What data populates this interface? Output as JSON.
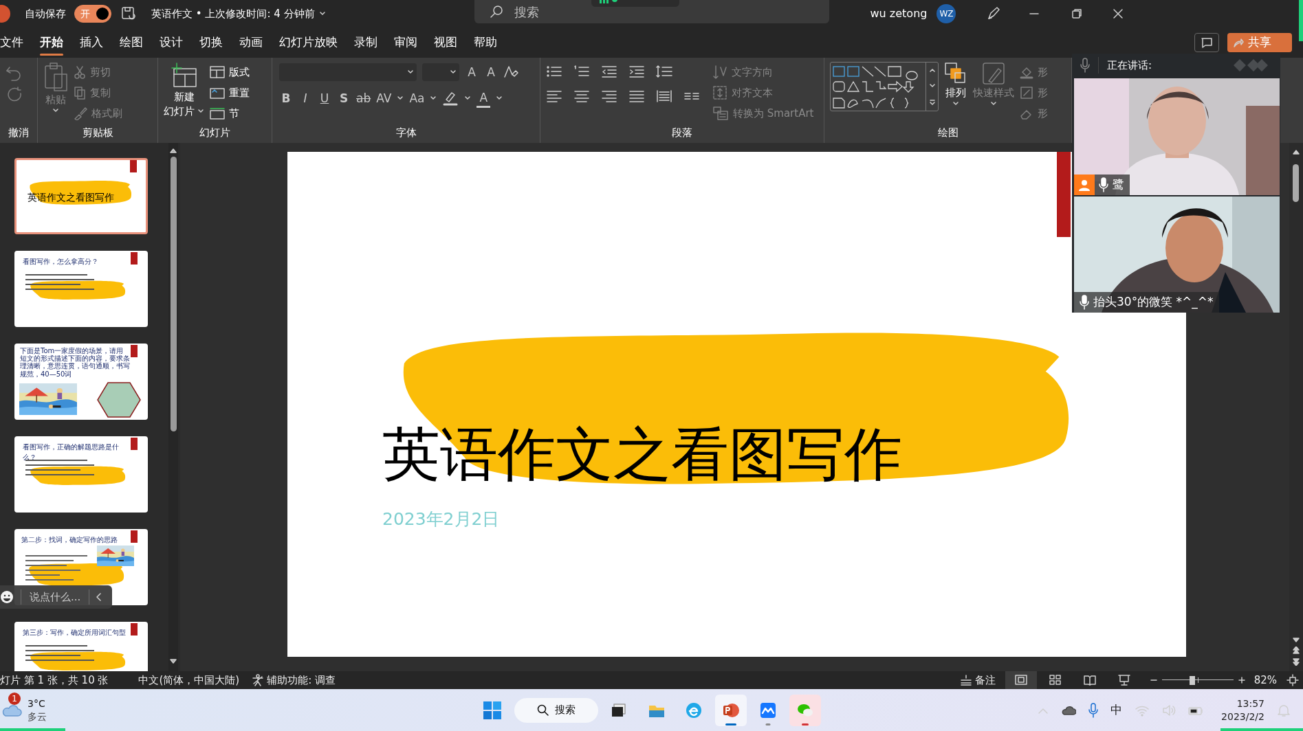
{
  "title_bar": {
    "autosave_label": "自动保存",
    "autosave_toggle": {
      "label": "开",
      "on": true
    },
    "document_title": "英语作文 • 上次修改时间: 4 分钟前",
    "search": {
      "placeholder": "搜索"
    },
    "user_name": "wu zetong",
    "avatar": "WZ"
  },
  "tabs": [
    {
      "label": "文件",
      "selected": false
    },
    {
      "label": "开始",
      "selected": true
    },
    {
      "label": "插入",
      "selected": false
    },
    {
      "label": "绘图",
      "selected": false
    },
    {
      "label": "设计",
      "selected": false
    },
    {
      "label": "切换",
      "selected": false
    },
    {
      "label": "动画",
      "selected": false
    },
    {
      "label": "幻灯片放映",
      "selected": false
    },
    {
      "label": "录制",
      "selected": false
    },
    {
      "label": "审阅",
      "selected": false
    },
    {
      "label": "视图",
      "selected": false
    },
    {
      "label": "帮助",
      "selected": false
    }
  ],
  "share_button": "共享",
  "ribbon": {
    "groups": [
      {
        "kind": "undo",
        "label": "撤消"
      },
      {
        "kind": "clipboard",
        "label": "剪贴板",
        "items": [
          {
            "label": "粘贴",
            "disabled": true
          },
          {
            "label": "剪切",
            "disabled": true
          },
          {
            "label": "复制",
            "disabled": true
          },
          {
            "label": "格式刷",
            "disabled": true
          }
        ]
      },
      {
        "kind": "slides",
        "label": "幻灯片",
        "new_slide": [
          "新建",
          "幻灯片"
        ],
        "items": [
          {
            "label": "版式",
            "disabled": false
          },
          {
            "label": "重置",
            "disabled": false
          },
          {
            "label": "节",
            "disabled": false
          }
        ]
      },
      {
        "kind": "font",
        "label": "字体",
        "glyphs": [
          "A",
          "A",
          "B",
          "I",
          "U",
          "S",
          "ab",
          "AV",
          "Aa",
          "A"
        ]
      },
      {
        "kind": "paragraph",
        "label": "段落",
        "items": [
          {
            "label": "文字方向",
            "disabled": true
          },
          {
            "label": "对齐文本",
            "disabled": true
          },
          {
            "label": "转换为 SmartArt",
            "disabled": true
          }
        ]
      },
      {
        "kind": "drawing",
        "label": "绘图",
        "items": [
          {
            "label": "排列",
            "disabled": false
          },
          {
            "label": "快速样式",
            "disabled": true
          }
        ],
        "shape_labels": [
          "形",
          "形",
          "形"
        ]
      }
    ]
  },
  "thumbnails": [
    {
      "kind": "cover",
      "title": "英语作文之看图写作",
      "selected": true
    },
    {
      "kind": "text",
      "title": "看图写作，怎么拿高分？",
      "selected": false
    },
    {
      "kind": "picture",
      "title": "下面是Tom一家度假的场景，请用短文的形式描述下面的内容，要求条理清晰，意思连贯，语句通顺，书写规范，40—50词",
      "selected": false
    },
    {
      "kind": "text",
      "title": "看图写作，正确的解题思路是什么？",
      "selected": false
    },
    {
      "kind": "corner_picture",
      "title": "第二步：找词，确定写作的思路",
      "selected": false
    },
    {
      "kind": "text",
      "title": "第三步：写作，确定所用词汇句型",
      "selected": false
    }
  ],
  "chat_input": {
    "placeholder": "说点什么..."
  },
  "slide": {
    "title": "英语作文之看图写作",
    "date": "2023年2月2日"
  },
  "video_panel": {
    "header": "正在讲话:",
    "participants": [
      {
        "name": "鹭",
        "host": true
      },
      {
        "name": "抬头30°的微笑 *^_^*",
        "host": false
      }
    ]
  },
  "status_bar": {
    "slide_position": "灯片 第 1 张，共 10 张",
    "language": "中文(简体，中国大陆)",
    "accessibility": "辅助功能: 调查",
    "notes": "备注",
    "views": [
      {
        "selected": true
      },
      {
        "selected": false
      },
      {
        "selected": false
      },
      {
        "selected": false
      }
    ],
    "zoom_slider": {
      "level": 0.43
    },
    "zoom": "82%"
  },
  "taskbar": {
    "weather": {
      "badge": "1",
      "temperature": "3°C",
      "condition": "多云"
    },
    "search": "搜索",
    "apps": [
      {
        "running": false,
        "active": false,
        "attention": false
      },
      {
        "running": false,
        "active": false,
        "attention": false
      },
      {
        "running": false,
        "active": false,
        "attention": false
      },
      {
        "running": true,
        "active": true,
        "attention": false
      },
      {
        "running": true,
        "active": false,
        "attention": false
      },
      {
        "running": true,
        "active": false,
        "attention": true
      }
    ],
    "ime": "中",
    "time": "13:57",
    "date": "2023/2/2"
  }
}
